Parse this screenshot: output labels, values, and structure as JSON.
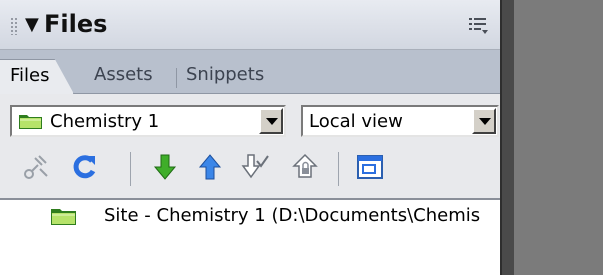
{
  "panel": {
    "title": "Files",
    "collapse_glyph": "▼",
    "tabs": [
      "Files",
      "Assets",
      "Snippets"
    ],
    "active_tab": "Files"
  },
  "site_select": {
    "value": "Chemistry 1",
    "icon": "folder-icon"
  },
  "view_select": {
    "value": "Local view"
  },
  "toolbar": {
    "buttons": [
      {
        "name": "connect-button",
        "icon": "connect-icon"
      },
      {
        "name": "refresh-button",
        "icon": "refresh-icon"
      },
      {
        "name": "get-button",
        "icon": "get-arrow-down-icon"
      },
      {
        "name": "put-button",
        "icon": "put-arrow-up-icon"
      },
      {
        "name": "check-out-button",
        "icon": "check-out-icon"
      },
      {
        "name": "check-in-button",
        "icon": "check-in-lock-icon"
      },
      {
        "name": "expand-button",
        "icon": "expand-window-icon"
      }
    ]
  },
  "file_list": {
    "rows": [
      {
        "label": "Site - Chemistry 1 (D:\\Documents\\Chemis",
        "icon": "folder-icon"
      }
    ]
  },
  "colors": {
    "folder": "#b6e36a",
    "accent_blue": "#2b6fe0",
    "accent_green": "#3fae2a"
  }
}
